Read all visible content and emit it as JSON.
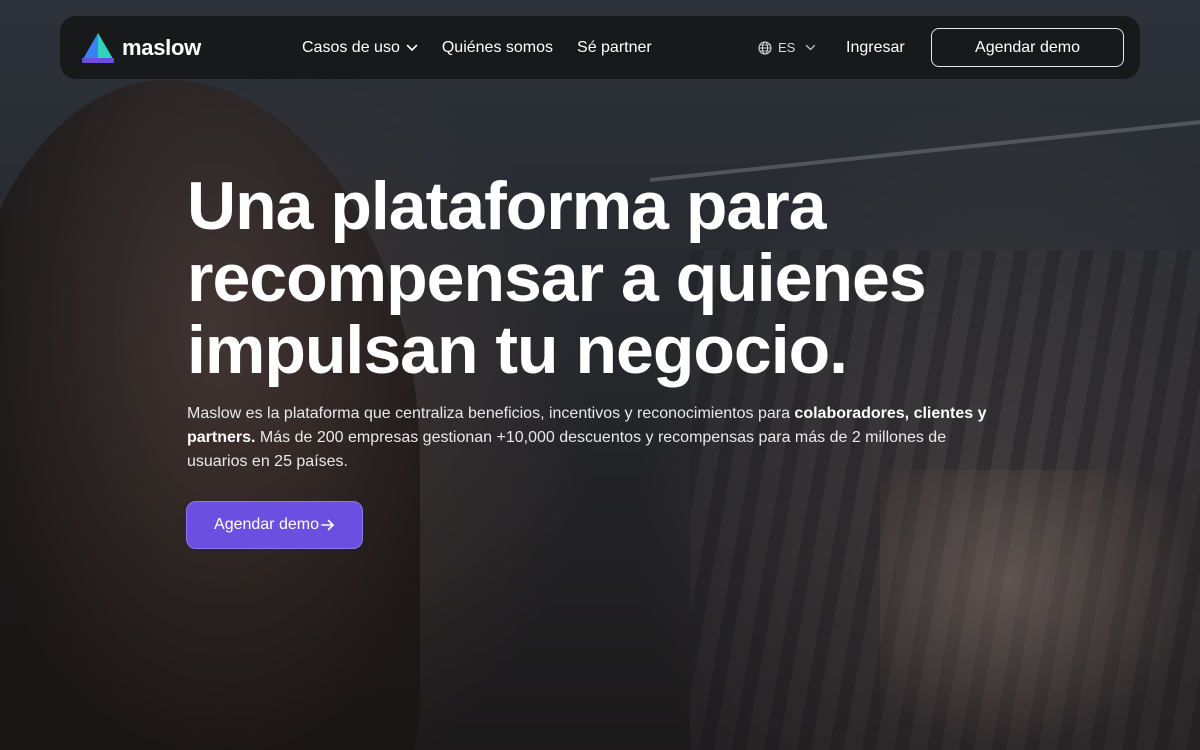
{
  "brand": {
    "name": "maslow",
    "colors": {
      "logo_blue": "#3b82f6",
      "logo_teal": "#2dd4bf",
      "logo_purple": "#6d4fe0",
      "cta_purple": "#6a4fe0"
    }
  },
  "nav": {
    "links": [
      {
        "label": "Casos de uso",
        "icon": "chevron-down-icon"
      },
      {
        "label": "Quiénes somos"
      },
      {
        "label": "Sé partner"
      }
    ],
    "language": {
      "label": "ES",
      "icon": "globe-icon"
    },
    "login_label": "Ingresar",
    "cta_label": "Agendar demo"
  },
  "hero": {
    "headline": "Una plataforma para recompensar a quienes impulsan tu negocio.",
    "subtitle_part1": "Maslow es la plataforma que centraliza beneficios, incentivos y reconocimientos para ",
    "subtitle_bold": "colaboradores, clientes y partners.",
    "subtitle_part2": " Más de 200 empresas gestionan +10,000 descuentos y recompensas para más de 2 millones de usuarios en 25 países.",
    "cta_label": "Agendar demo",
    "cta_icon": "arrow-right-icon"
  }
}
